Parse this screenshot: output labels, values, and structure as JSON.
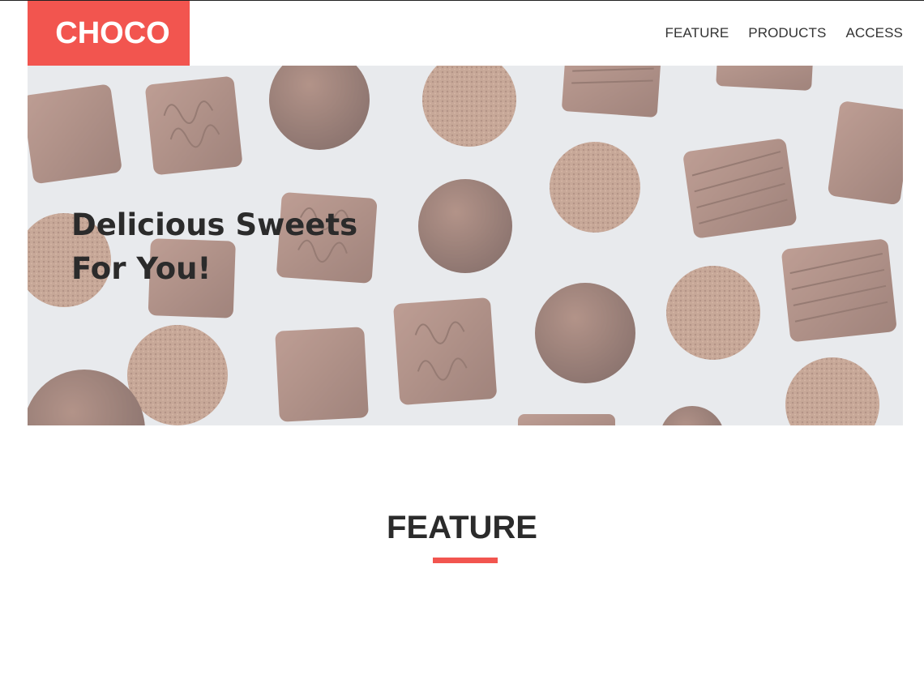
{
  "header": {
    "logo_text": "CHOCO",
    "nav": [
      {
        "label": "FEATURE"
      },
      {
        "label": "PRODUCTS"
      },
      {
        "label": "ACCESS"
      }
    ]
  },
  "hero": {
    "title": "Delicious Sweets\nFor You!",
    "image": "chocolate-assortment"
  },
  "feature_section": {
    "title": "FEATURE"
  },
  "colors": {
    "accent": "#f2554f",
    "text": "#2b2b2b",
    "background": "#ffffff"
  }
}
